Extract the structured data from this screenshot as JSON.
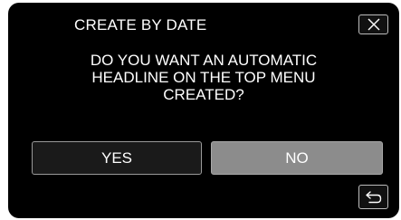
{
  "dialog": {
    "title": "CREATE BY DATE",
    "message_lines": [
      "DO YOU WANT AN AUTOMATIC",
      "HEADLINE ON THE TOP MENU",
      "CREATED?"
    ]
  },
  "buttons": {
    "yes_label": "YES",
    "no_label": "NO"
  },
  "icons": {
    "close": "close-icon",
    "back": "back-arrow-icon"
  },
  "colors": {
    "screen_bg": "#000000",
    "text": "#ffffff",
    "yes_bg": "#1a1a1a",
    "no_bg_selected": "#8c8c8c"
  }
}
